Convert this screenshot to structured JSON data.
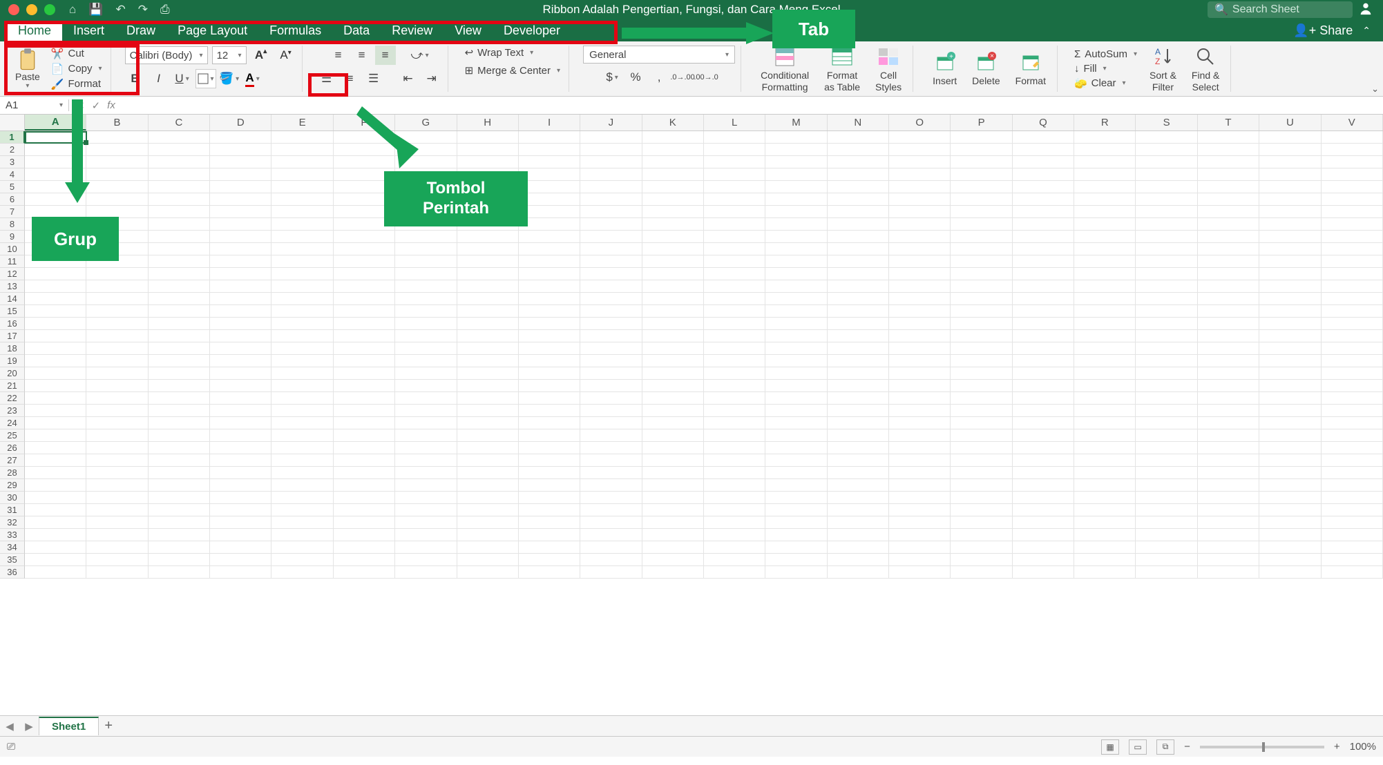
{
  "title": "Ribbon Adalah Pengertian, Fungsi, dan Cara Meng                  Excel",
  "search_placeholder": "Search Sheet",
  "share_label": "Share",
  "tabs": [
    "Home",
    "Insert",
    "Draw",
    "Page Layout",
    "Formulas",
    "Data",
    "Review",
    "View",
    "Developer"
  ],
  "active_tab": "Home",
  "clipboard": {
    "paste": "Paste",
    "cut": "Cut",
    "copy": "Copy",
    "format": "Format"
  },
  "font": {
    "name": "Calibri (Body)",
    "size": "12"
  },
  "alignment": {
    "wrap": "Wrap Text",
    "merge": "Merge & Center"
  },
  "number": {
    "format": "General"
  },
  "styles": {
    "cond": "Conditional\nFormatting",
    "table": "Format\nas Table",
    "cell": "Cell\nStyles"
  },
  "cells": {
    "insert": "Insert",
    "delete": "Delete",
    "format": "Format"
  },
  "editing": {
    "autosum": "AutoSum",
    "fill": "Fill",
    "clear": "Clear",
    "sort": "Sort &\nFilter",
    "find": "Find &\nSelect"
  },
  "name_box": "A1",
  "columns": [
    "A",
    "B",
    "C",
    "D",
    "E",
    "F",
    "G",
    "H",
    "I",
    "J",
    "K",
    "L",
    "M",
    "N",
    "O",
    "P",
    "Q",
    "R",
    "S",
    "T",
    "U",
    "V"
  ],
  "row_count": 36,
  "sheet_name": "Sheet1",
  "zoom": "100%",
  "annotations": {
    "tab": "Tab",
    "grup": "Grup",
    "tombol": "Tombol\nPerintah"
  }
}
